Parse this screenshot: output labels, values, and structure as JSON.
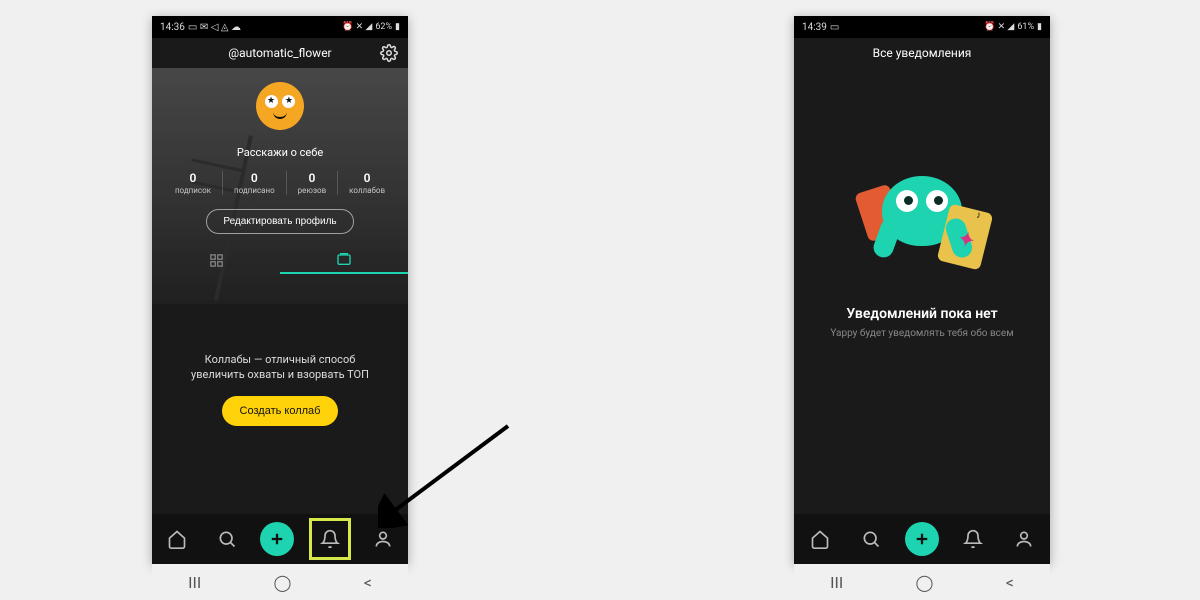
{
  "left": {
    "statusbar": {
      "time": "14:36",
      "battery": "62%"
    },
    "header": {
      "username": "@automatic_flower"
    },
    "profile": {
      "bio_prompt": "Расскажи о себе",
      "stats": [
        {
          "num": "0",
          "label": "подписок"
        },
        {
          "num": "0",
          "label": "подписано"
        },
        {
          "num": "0",
          "label": "реюзов"
        },
        {
          "num": "0",
          "label": "коллабов"
        }
      ],
      "edit_label": "Редактировать профиль"
    },
    "promo": {
      "line1": "Коллабы — отличный способ",
      "line2": "увеличить охваты и взорвать ТОП",
      "button": "Создать коллаб"
    }
  },
  "right": {
    "statusbar": {
      "time": "14:39",
      "battery": "61%"
    },
    "header": {
      "title": "Все уведомления"
    },
    "empty": {
      "title": "Уведомлений пока нет",
      "subtitle": "Yappy будет уведомлять тебя обо всем"
    }
  },
  "sysnav": {
    "recents": "III",
    "home": "◯",
    "back": "<"
  }
}
